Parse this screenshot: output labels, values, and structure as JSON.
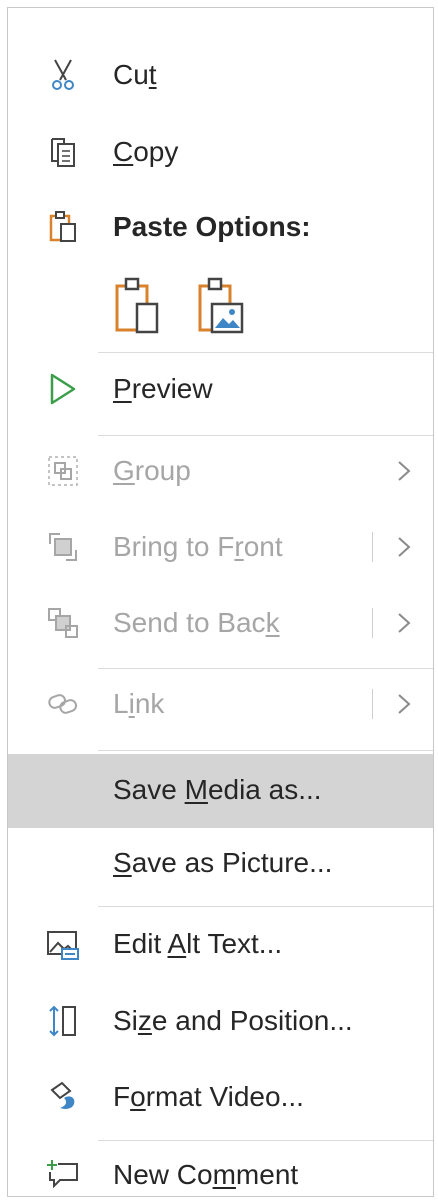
{
  "menu": {
    "items": [
      {
        "id": "cut",
        "label_before": "Cu",
        "label_ul": "t",
        "label_after": "",
        "icon": "scissors-icon"
      },
      {
        "id": "copy",
        "label_before": "",
        "label_ul": "C",
        "label_after": "opy",
        "icon": "copy-icon"
      },
      {
        "id": "paste_options",
        "label": "Paste Options:",
        "icon": "clipboard-icon"
      },
      {
        "id": "preview",
        "label_before": "",
        "label_ul": "P",
        "label_after": "review",
        "icon": "play-icon"
      },
      {
        "id": "group",
        "label_before": "",
        "label_ul": "G",
        "label_after": "roup",
        "icon": "group-icon"
      },
      {
        "id": "bring_front",
        "label_before": "Bring to F",
        "label_ul": "r",
        "label_after": "ont",
        "icon": "bring-to-front-icon"
      },
      {
        "id": "send_back",
        "label_before": "Send to Bac",
        "label_ul": "k",
        "label_after": "",
        "icon": "send-to-back-icon"
      },
      {
        "id": "link",
        "label_before": "L",
        "label_ul": "i",
        "label_after": "nk",
        "icon": "link-icon"
      },
      {
        "id": "save_media",
        "label_before": "Save ",
        "label_ul": "M",
        "label_after": "edia as...",
        "icon": ""
      },
      {
        "id": "save_picture",
        "label_before": "",
        "label_ul": "S",
        "label_after": "ave as Picture...",
        "icon": ""
      },
      {
        "id": "alt_text",
        "label_before": "Edit ",
        "label_ul": "A",
        "label_after": "lt Text...",
        "icon": "alt-text-icon"
      },
      {
        "id": "size_position",
        "label_before": "Si",
        "label_ul": "z",
        "label_after": "e and Position...",
        "icon": "size-position-icon"
      },
      {
        "id": "format_video",
        "label_before": "F",
        "label_ul": "o",
        "label_after": "rmat Video...",
        "icon": "format-video-icon"
      },
      {
        "id": "new_comment",
        "label_before": "New Co",
        "label_ul": "m",
        "label_after": "ment",
        "icon": "new-comment-icon"
      }
    ],
    "paste_choices": [
      "paste-keep-formatting-icon",
      "paste-picture-icon"
    ]
  },
  "colors": {
    "accent_orange": "#d9822b",
    "play_green": "#3c9e4b",
    "text": "#262626",
    "disabled": "#a6a6a6",
    "highlight": "#d4d4d4",
    "blue": "#3f86c7"
  }
}
